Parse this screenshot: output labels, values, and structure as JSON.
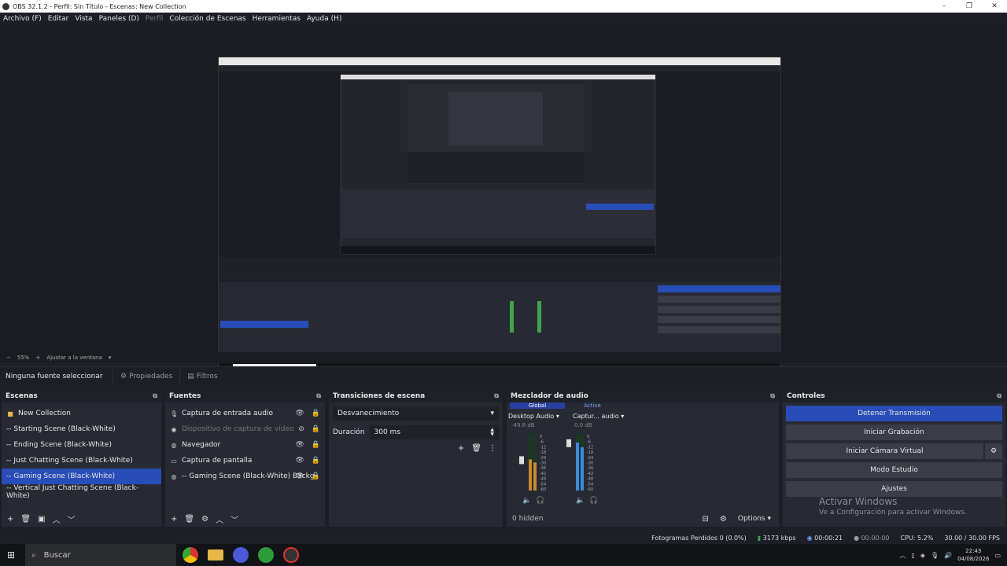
{
  "window": {
    "title": "OBS 32.1.2 - Perfil: Sin Título - Escenas: New Collection",
    "minimize": "–",
    "maximize": "❐",
    "close": "✕"
  },
  "menu": [
    "Archivo (F)",
    "Editar",
    "Vista",
    "Paneles (D)",
    "Perfil",
    "Colección de Escenas",
    "Herramientas",
    "Ayuda (H)"
  ],
  "zoom": {
    "value": "55%",
    "fit": "Ajustar a la ventana"
  },
  "source_bar": {
    "label": "Ninguna fuente seleccionar",
    "properties": "Propiedades",
    "filters": "Filtros"
  },
  "scenes": {
    "title": "Escenas",
    "items": [
      "New Collection",
      "-- Starting Scene (Black-White)",
      "-- Ending Scene (Black-White)",
      "-- Just Chatting Scene (Black-White)",
      "-- Gaming Scene (Black-White)",
      "-- Vertical Just Chatting Scene (Black-White)"
    ],
    "selected_index": 4
  },
  "sources": {
    "title": "Fuentes",
    "items": [
      {
        "label": "Captura de entrada audio",
        "icon": "microphone-icon"
      },
      {
        "label": "Dispositivo de captura de vídeo",
        "icon": "camera-icon"
      },
      {
        "label": "Navegador",
        "icon": "globe-icon"
      },
      {
        "label": "Captura de pantalla",
        "icon": "monitor-icon"
      },
      {
        "label": "-- Gaming Scene (Black-White) Backg",
        "icon": "globe-icon"
      }
    ]
  },
  "transitions": {
    "title": "Transiciones de escena",
    "selected": "Desvanecimiento",
    "duration_label": "Duración",
    "duration_value": "300 ms"
  },
  "mixer": {
    "title": "Mezclador de audio",
    "tabs": [
      "Global",
      "Active"
    ],
    "channels": [
      {
        "name": "Desktop Audio",
        "db": "-49.8 dB",
        "level": 0.55
      },
      {
        "name": "Captur... audio",
        "db": "0.0 dB",
        "level": 0.85
      }
    ],
    "scale": [
      "0",
      "-6",
      "-12",
      "-18",
      "-24",
      "-30",
      "-36",
      "-42",
      "-48",
      "-54",
      "-60"
    ],
    "hidden": "0 hidden",
    "options": "Options"
  },
  "controls": {
    "title": "Controles",
    "buttons": [
      "Detener Transmisión",
      "Iniciar Grabación",
      "Iniciar Cámara Virtual",
      "Modo Estudio",
      "Ajustes"
    ]
  },
  "watermark": {
    "title": "Activar Windows",
    "subtitle": "Ve a Configuración para activar Windows."
  },
  "status": {
    "dropped": "Fotogramas Perdidos 0 (0.0%)",
    "bitrate": "3173 kbps",
    "stream_time": "00:00:21",
    "rec_time": "00:00:00",
    "cpu": "CPU: 5.2%",
    "fps": "30.00 / 30.00 FPS"
  },
  "taskbar": {
    "search": "Buscar",
    "time": "22:43",
    "date": "04/08/2026"
  },
  "colors": {
    "accent": "#284cb8",
    "panel": "#272a33",
    "background": "#1d1f26"
  }
}
